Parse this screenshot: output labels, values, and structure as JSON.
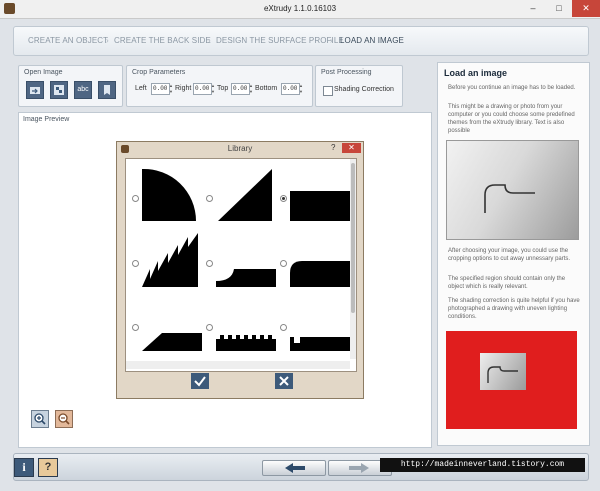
{
  "window": {
    "title": "eXtrudy 1.1.0.16103",
    "minimize": "–",
    "maximize": "□",
    "close": "✕"
  },
  "breadcrumb": {
    "steps": [
      "CREATE AN OBJECT",
      "CREATE THE BACK SIDE",
      "DESIGN THE SURFACE PROFILE",
      "LOAD AN IMAGE"
    ],
    "separator": "›"
  },
  "toolbar": {
    "open_image": {
      "label": "Open Image",
      "buttons": [
        "open-file-icon",
        "image-icon",
        "abc-text-icon",
        "bookmark-library-icon"
      ],
      "text_button": "abc"
    },
    "crop": {
      "label": "Crop Parameters",
      "fields": [
        {
          "label": "Left",
          "value": "0.00"
        },
        {
          "label": "Right",
          "value": "0.00"
        },
        {
          "label": "Top",
          "value": "0.00"
        },
        {
          "label": "Bottom",
          "value": "0.00"
        }
      ]
    },
    "post": {
      "label": "Post Processing",
      "checkbox_label": "Shading Correction",
      "checked": false
    }
  },
  "preview": {
    "label": "Image Preview"
  },
  "library": {
    "title": "Library",
    "help": "?",
    "close": "✕",
    "selected_index": 2,
    "items": [
      "quarter-circle-profile",
      "ramp-profile",
      "step-profile",
      "sawtooth-profile",
      "low-fillet-profile",
      "rounded-step-profile",
      "chamfer-profile",
      "crenellated-profile",
      "notched-profile"
    ],
    "ok": "✔",
    "cancel": "✖"
  },
  "help_panel": {
    "title": "Load an image",
    "paragraphs": [
      "Before you continue an image has to be loaded.",
      "This might be a drawing or photo from your computer or you could choose some predefined themes from the eXtrudy library. Text is also possible",
      "After choosing your image, you could use the cropping options to cut away unnessary parts.",
      "The specified region should contain only the object which is really relevant.",
      "The shading correction is quite helpful if you have photographed a drawing with uneven lighting conditions."
    ],
    "accent_red": "#e01e1e"
  },
  "bottom": {
    "info": "i",
    "help": "?",
    "watermark": "http://madeinneverland.tistory.com"
  }
}
